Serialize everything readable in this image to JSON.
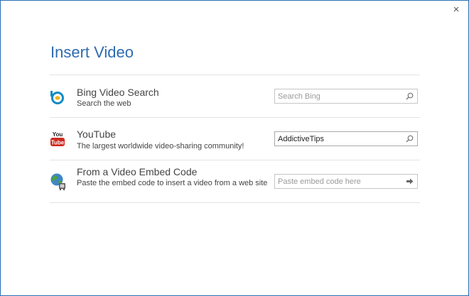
{
  "dialog": {
    "title": "Insert Video",
    "close_glyph": "×"
  },
  "sources": [
    {
      "name": "Bing Video Search",
      "description": "Search the web",
      "icon": "bing-icon",
      "input_value": "",
      "input_placeholder": "Search Bing",
      "action_icon": "search-icon"
    },
    {
      "name": "YouTube",
      "description": "The largest worldwide video-sharing community!",
      "icon": "youtube-icon",
      "input_value": "AddictiveTips",
      "input_placeholder": "",
      "action_icon": "search-icon"
    },
    {
      "name": "From a Video Embed Code",
      "description": "Paste the embed code to insert a video from a web site",
      "icon": "globe-embed-icon",
      "input_value": "",
      "input_placeholder": "Paste embed code here",
      "action_icon": "arrow-right-icon"
    }
  ],
  "colors": {
    "title": "#2e6bb0",
    "border": "#2b6fb6",
    "bing": "#0f8bc3",
    "youtube_red": "#cc2a1e"
  }
}
